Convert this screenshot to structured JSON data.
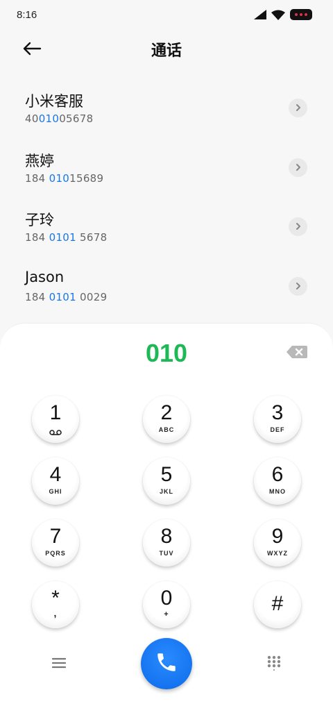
{
  "status_bar": {
    "time": "8:16",
    "icons": [
      "cellular-signal-icon",
      "wifi-icon",
      "battery-icon"
    ]
  },
  "header": {
    "title": "通话",
    "back_icon": "arrow-left-icon"
  },
  "contacts": [
    {
      "name": "小米客服",
      "number_parts": [
        "40",
        "010",
        "05678"
      ]
    },
    {
      "name": "燕婷",
      "number_parts": [
        "184 ",
        "010",
        "15689"
      ]
    },
    {
      "name": "子玲",
      "number_parts": [
        "184 ",
        "0101",
        " 5678"
      ]
    },
    {
      "name": "Jason",
      "number_parts": [
        "184 ",
        "0101",
        " 0029"
      ]
    }
  ],
  "dialpad": {
    "input_value": "010",
    "keys": [
      {
        "digit": "1",
        "letters": ""
      },
      {
        "digit": "2",
        "letters": "ABC"
      },
      {
        "digit": "3",
        "letters": "DEF"
      },
      {
        "digit": "4",
        "letters": "GHI"
      },
      {
        "digit": "5",
        "letters": "JKL"
      },
      {
        "digit": "6",
        "letters": "MNO"
      },
      {
        "digit": "7",
        "letters": "PQRS"
      },
      {
        "digit": "8",
        "letters": "TUV"
      },
      {
        "digit": "9",
        "letters": "WXYZ"
      },
      {
        "digit": "*",
        "letters": ","
      },
      {
        "digit": "0",
        "letters": "+"
      },
      {
        "digit": "#",
        "letters": ""
      }
    ]
  },
  "colors": {
    "match_highlight": "#1877e6",
    "dial_input": "#1db954",
    "call_button": "#1574f0"
  }
}
